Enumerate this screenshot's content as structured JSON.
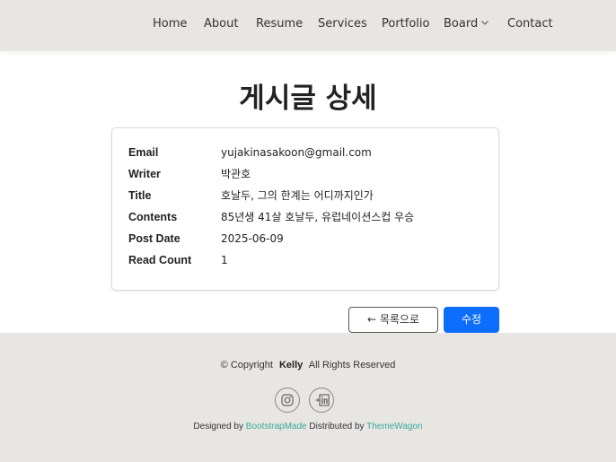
{
  "nav": {
    "items": [
      {
        "label": "Home"
      },
      {
        "label": "About"
      },
      {
        "label": "Resume"
      },
      {
        "label": "Services"
      },
      {
        "label": "Portfolio"
      },
      {
        "label": "Board"
      },
      {
        "label": "Contact"
      }
    ]
  },
  "page": {
    "title": "게시글 상세"
  },
  "detail": {
    "rows": [
      {
        "label": "Email",
        "value": "yujakinasakoon@gmail.com"
      },
      {
        "label": "Writer",
        "value": "박관호"
      },
      {
        "label": "Title",
        "value": "호날두, 그의 한계는 어디까지인가"
      },
      {
        "label": "Contents",
        "value": "85년생 41살 호날두, 유럽네이션스컵 우승"
      },
      {
        "label": "Post Date",
        "value": "2025-06-09"
      },
      {
        "label": "Read Count",
        "value": "1"
      }
    ]
  },
  "buttons": {
    "list_label": "← 목록으로",
    "edit_label": "수정"
  },
  "footer": {
    "copyright_prefix": "© Copyright",
    "copyright_name": "Kelly",
    "copyright_suffix": "All Rights Reserved",
    "designed_by_prefix": "Designed by",
    "designed_by_link": "BootstrapMade",
    "distributed_by_prefix": "Distributed by",
    "distributed_by_link": "ThemeWagon",
    "social": [
      {
        "icon": "instagram-icon"
      },
      {
        "icon": "linkedin-icon"
      }
    ]
  },
  "colors": {
    "accent": "#0d6efd",
    "link": "#3aa89a",
    "band": "#e8e6e3"
  }
}
